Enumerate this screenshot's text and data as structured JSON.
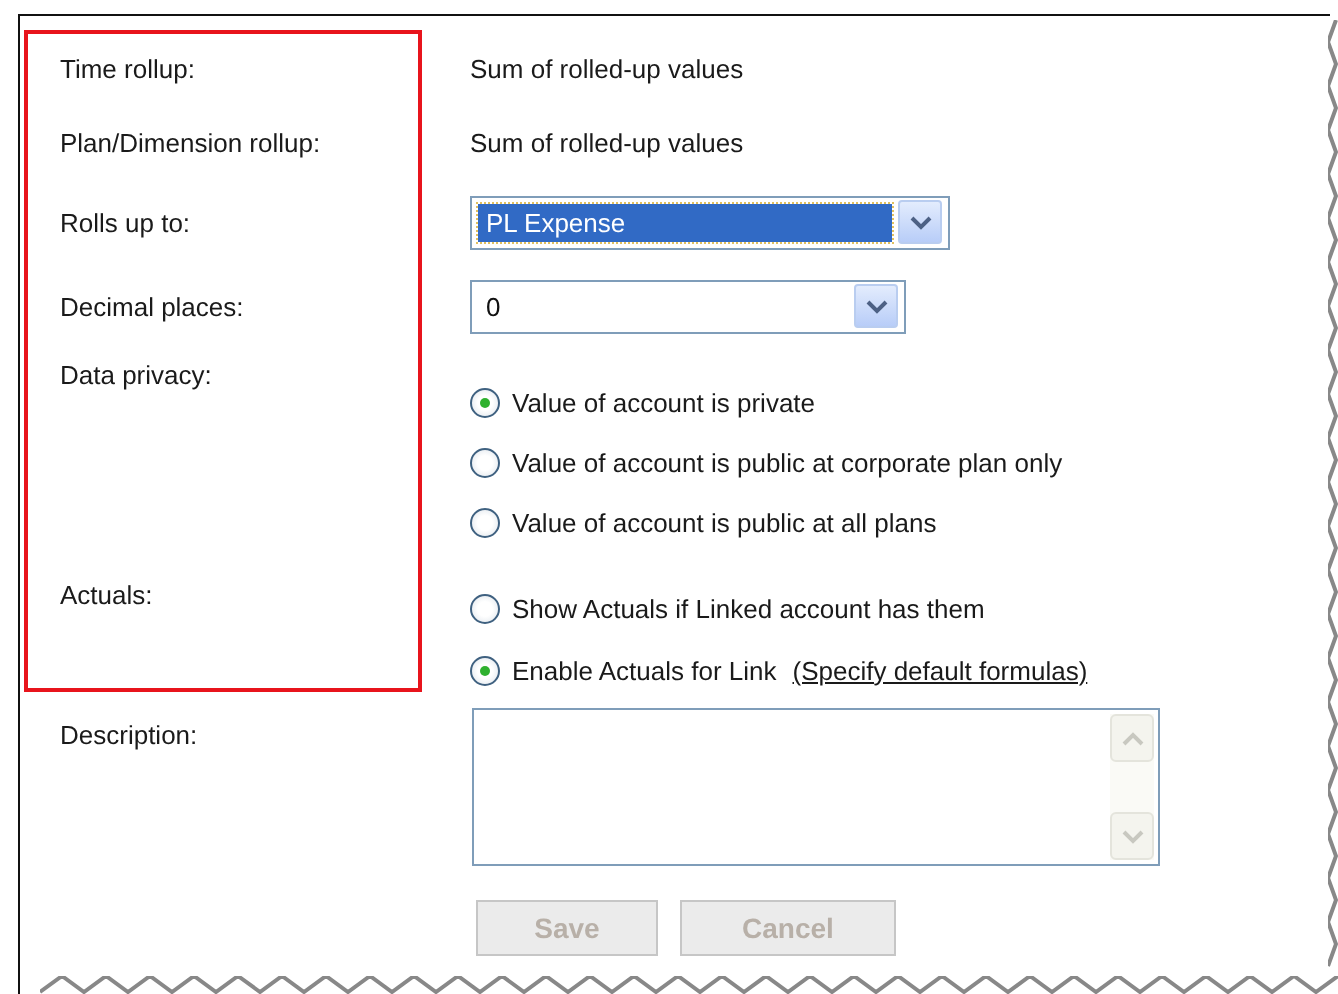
{
  "fields": [
    {
      "label": "Time rollup:",
      "kind": "text",
      "value": "Sum of rolled-up values"
    },
    {
      "label": "Plan/Dimension rollup:",
      "kind": "text",
      "value": "Sum of rolled-up values"
    },
    {
      "label": "Rolls up to:",
      "kind": "select",
      "value": "PL Expense",
      "focused": true,
      "wide": true
    },
    {
      "label": "Decimal places:",
      "kind": "select",
      "value": "0",
      "focused": false,
      "wide": false
    },
    {
      "label": "Data privacy:",
      "kind": "radios",
      "options": [
        {
          "label": "Value of account is private",
          "selected": true
        },
        {
          "label": "Value of account is public at corporate plan only",
          "selected": false
        },
        {
          "label": "Value of account is public at all plans",
          "selected": false
        }
      ]
    },
    {
      "label": "Actuals:",
      "kind": "radios",
      "options": [
        {
          "label": "Show Actuals if Linked account has them",
          "selected": false
        },
        {
          "label": "Enable Actuals for Link",
          "link": "(Specify default formulas)",
          "selected": true
        }
      ]
    }
  ],
  "description": {
    "label": "Description:"
  },
  "buttons": [
    {
      "label": "Save",
      "disabled": true
    },
    {
      "label": "Cancel",
      "disabled": true
    }
  ]
}
